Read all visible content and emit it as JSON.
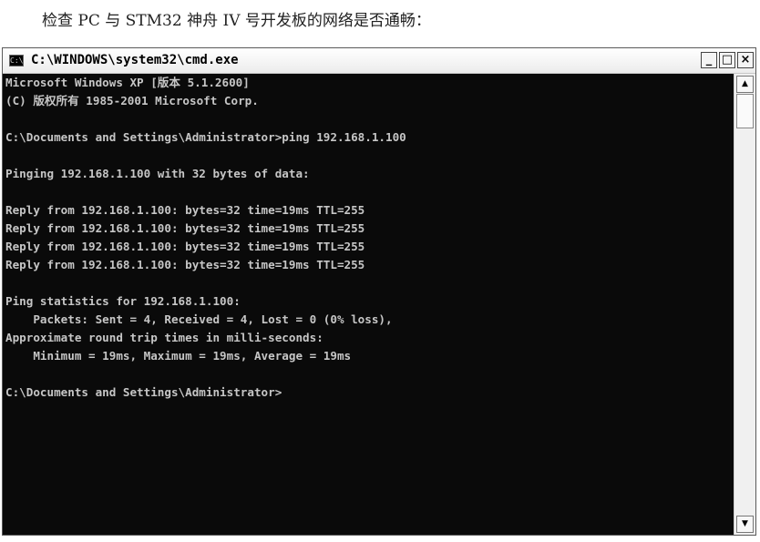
{
  "document": {
    "caption": "检查 PC 与 STM32 神舟 IV 号开发板的网络是否通畅："
  },
  "window": {
    "icon_text": "C:\\",
    "title": "C:\\WINDOWS\\system32\\cmd.exe",
    "minimize_label": "_",
    "maximize_label": "□",
    "close_label": "×"
  },
  "console": {
    "lines": [
      "Microsoft Windows XP [版本 5.1.2600]",
      "(C) 版权所有 1985-2001 Microsoft Corp.",
      "",
      "C:\\Documents and Settings\\Administrator>ping 192.168.1.100",
      "",
      "Pinging 192.168.1.100 with 32 bytes of data:",
      "",
      "Reply from 192.168.1.100: bytes=32 time=19ms TTL=255",
      "Reply from 192.168.1.100: bytes=32 time=19ms TTL=255",
      "Reply from 192.168.1.100: bytes=32 time=19ms TTL=255",
      "Reply from 192.168.1.100: bytes=32 time=19ms TTL=255",
      "",
      "Ping statistics for 192.168.1.100:",
      "    Packets: Sent = 4, Received = 4, Lost = 0 (0% loss),",
      "Approximate round trip times in milli-seconds:",
      "    Minimum = 19ms, Maximum = 19ms, Average = 19ms",
      "",
      "C:\\Documents and Settings\\Administrator>"
    ]
  },
  "scrollbar": {
    "up_arrow": "▲",
    "down_arrow": "▼"
  }
}
